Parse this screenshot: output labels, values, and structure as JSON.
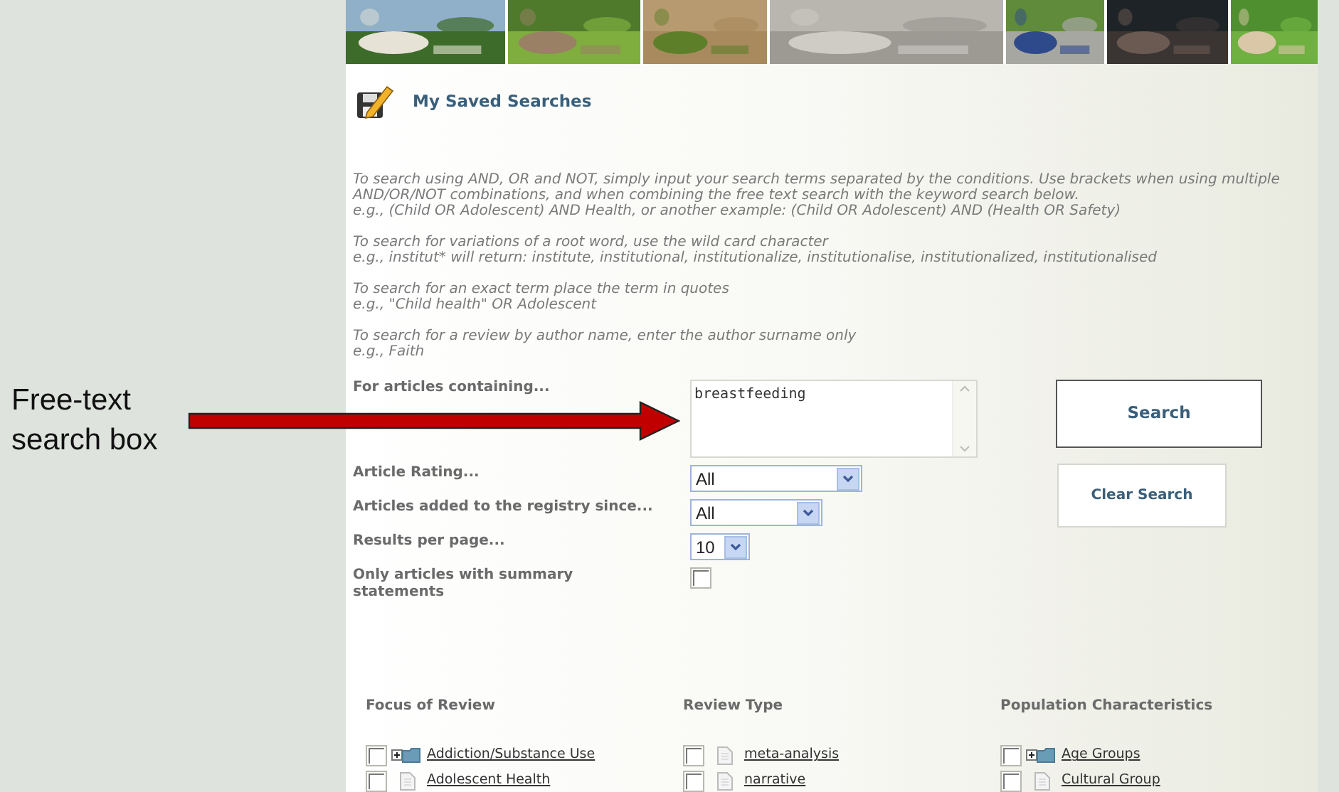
{
  "banner": [
    {
      "kind": "picture"
    },
    {
      "kind": "picture"
    },
    {
      "kind": "picture"
    },
    {
      "kind": "picture"
    },
    {
      "kind": "picture"
    },
    {
      "kind": "picture"
    },
    {
      "kind": "picture"
    }
  ],
  "annotation": {
    "lines": [
      "Free-text",
      "search box"
    ]
  },
  "page_title": "My Saved Searches",
  "help": [
    [
      "To search using AND, OR and NOT, simply input your search terms separated by the conditions. Use brackets when using multiple",
      "AND/OR/NOT combinations, and when combining the free text search with the keyword search below.",
      "e.g., (Child OR Adolescent) AND Health, or another example: (Child OR Adolescent) AND (Health OR Safety)"
    ],
    [
      "To search for variations of a root word, use the wild card character",
      "e.g., institut* will return: institute, institutional, institutionalize, institutionalise, institutionalized, institutionalised"
    ],
    [
      "To search for an exact term place the term in quotes",
      "e.g., \"Child health\" OR Adolescent"
    ],
    [
      "To search for a review by author name, enter the author surname only",
      "e.g., Faith"
    ]
  ],
  "form": [
    {
      "kind": "textarea",
      "label": "For articles containing...",
      "value": "breastfeeding"
    },
    {
      "kind": "select",
      "label": "Article Rating...",
      "value": "All"
    },
    {
      "kind": "select",
      "label": "Articles added to the registry since...",
      "value": "All"
    },
    {
      "kind": "select",
      "label": "Results per page...",
      "value": "10"
    },
    {
      "kind": "checkbox",
      "label": "Only articles with summary statements",
      "checked": false
    }
  ],
  "buttons": [
    {
      "kind": "primary",
      "label": "Search"
    },
    {
      "kind": "secondary",
      "label": "Clear Search"
    }
  ],
  "facets": [
    {
      "title": "Focus of Review",
      "items": [
        {
          "label": "Addiction/Substance Use",
          "kind": "folder",
          "checked": false
        },
        {
          "label": "Adolescent Health",
          "kind": "document",
          "checked": false
        }
      ]
    },
    {
      "title": "Review Type",
      "items": [
        {
          "label": "meta-analysis",
          "kind": "document",
          "checked": false
        },
        {
          "label": "narrative",
          "kind": "document",
          "checked": false
        }
      ]
    },
    {
      "title": "Population Characteristics",
      "items": [
        {
          "label": "Age Groups",
          "kind": "folder",
          "checked": false
        },
        {
          "label": "Cultural Group",
          "kind": "document",
          "checked": false
        }
      ]
    }
  ]
}
